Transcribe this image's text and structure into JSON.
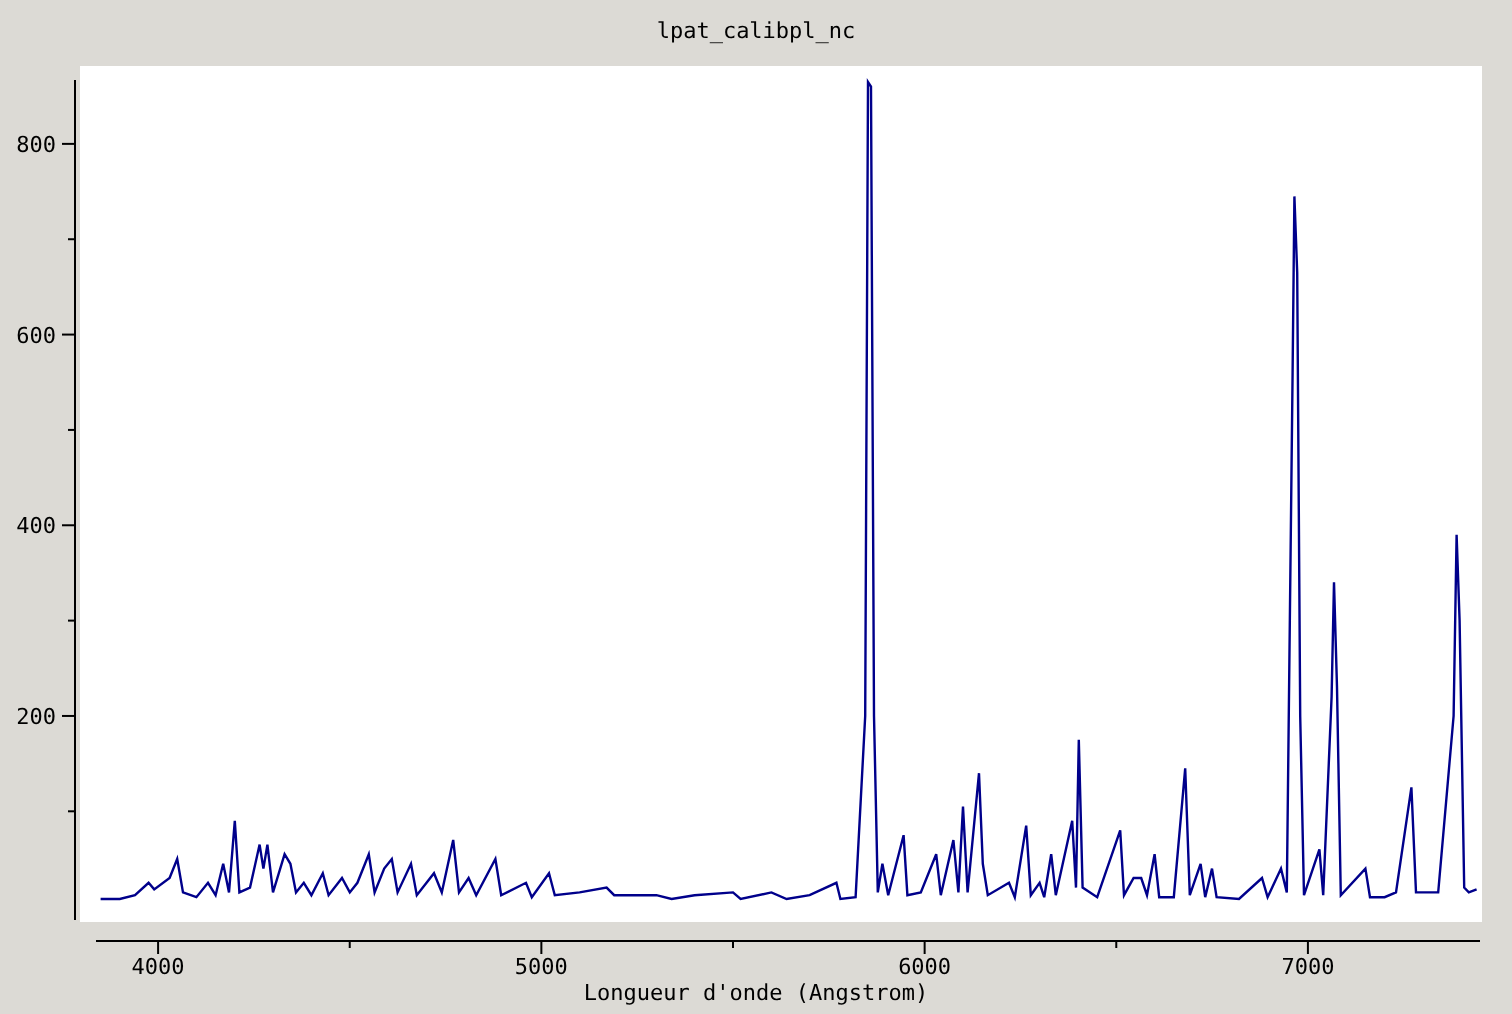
{
  "plot": {
    "chart_data": {
      "type": "line",
      "title": "lpat_calibpl_nc",
      "xlabel": "Longueur d'onde (Angstrom)",
      "xlim": [
        3838,
        7449
      ],
      "ylim": [
        -14,
        867
      ],
      "xticks": [
        4000,
        5000,
        6000,
        7000
      ],
      "yticks": [
        200,
        400,
        600,
        800
      ],
      "x": [
        3850,
        3900,
        3940,
        3975,
        3990,
        4030,
        4050,
        4065,
        4100,
        4130,
        4150,
        4170,
        4185,
        4200,
        4212,
        4240,
        4265,
        4275,
        4285,
        4300,
        4330,
        4345,
        4360,
        4380,
        4400,
        4430,
        4445,
        4480,
        4500,
        4520,
        4550,
        4565,
        4590,
        4610,
        4625,
        4660,
        4675,
        4720,
        4740,
        4770,
        4785,
        4810,
        4830,
        4880,
        4895,
        4960,
        4975,
        5020,
        5035,
        5100,
        5170,
        5190,
        5300,
        5340,
        5400,
        5500,
        5520,
        5600,
        5640,
        5700,
        5770,
        5780,
        5820,
        5845,
        5852,
        5860,
        5868,
        5878,
        5890,
        5905,
        5945,
        5955,
        5990,
        6030,
        6042,
        6075,
        6088,
        6100,
        6112,
        6142,
        6152,
        6165,
        6220,
        6235,
        6265,
        6277,
        6300,
        6312,
        6330,
        6342,
        6385,
        6395,
        6402,
        6412,
        6450,
        6510,
        6520,
        6545,
        6565,
        6580,
        6600,
        6612,
        6650,
        6680,
        6692,
        6720,
        6732,
        6750,
        6762,
        6820,
        6880,
        6895,
        6930,
        6945,
        6960,
        6965,
        6972,
        6980,
        6990,
        7030,
        7040,
        7062,
        7068,
        7076,
        7086,
        7150,
        7162,
        7200,
        7230,
        7270,
        7282,
        7340,
        7380,
        7388,
        7396,
        7408,
        7420,
        7440
      ],
      "series": [
        {
          "color": "#00008b",
          "values": [
            8,
            8,
            12,
            25,
            18,
            30,
            50,
            15,
            10,
            25,
            12,
            45,
            15,
            90,
            15,
            20,
            65,
            40,
            65,
            15,
            55,
            45,
            15,
            25,
            12,
            35,
            12,
            30,
            15,
            25,
            55,
            15,
            40,
            50,
            15,
            45,
            12,
            35,
            15,
            70,
            15,
            30,
            12,
            50,
            12,
            25,
            10,
            35,
            12,
            15,
            20,
            12,
            12,
            8,
            12,
            15,
            8,
            15,
            8,
            12,
            25,
            8,
            10,
            200,
            865,
            860,
            200,
            15,
            45,
            12,
            75,
            12,
            15,
            55,
            12,
            70,
            15,
            105,
            15,
            140,
            45,
            12,
            25,
            10,
            85,
            12,
            25,
            10,
            55,
            12,
            90,
            20,
            175,
            20,
            10,
            80,
            12,
            30,
            30,
            12,
            55,
            10,
            10,
            145,
            12,
            45,
            10,
            40,
            10,
            8,
            30,
            10,
            40,
            15,
            560,
            745,
            665,
            200,
            12,
            60,
            12,
            220,
            340,
            230,
            12,
            40,
            10,
            10,
            15,
            125,
            15,
            15,
            200,
            390,
            300,
            20,
            15,
            18
          ]
        }
      ]
    }
  }
}
